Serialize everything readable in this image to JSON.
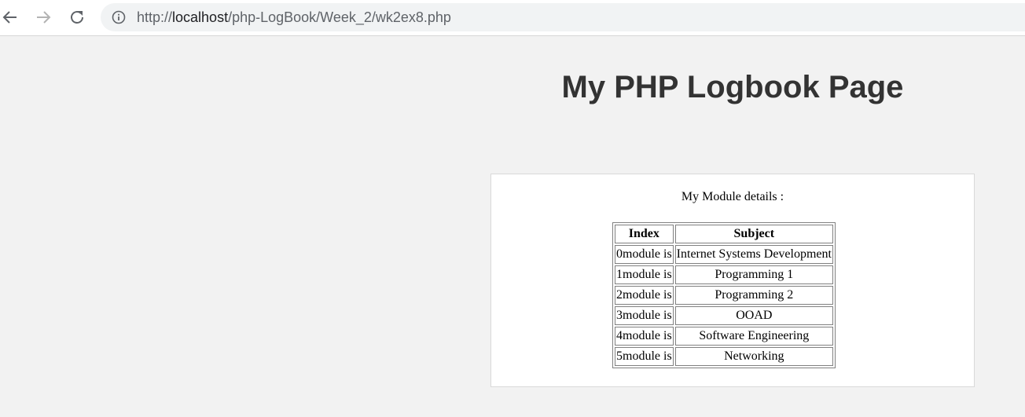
{
  "browser": {
    "url_prefix": "http://",
    "url_host": "localhost",
    "url_path": "/php-LogBook/Week_2/wk2ex8.php"
  },
  "page": {
    "title": "My PHP Logbook Page",
    "caption": "My Module details :"
  },
  "table": {
    "headers": {
      "index": "Index",
      "subject": "Subject"
    },
    "rows": [
      {
        "index": "0module is",
        "subject": "Internet Systems Development"
      },
      {
        "index": "1module is",
        "subject": "Programming 1"
      },
      {
        "index": "2module is",
        "subject": "Programming 2"
      },
      {
        "index": "3module is",
        "subject": "OOAD"
      },
      {
        "index": "4module is",
        "subject": "Software Engineering"
      },
      {
        "index": "5module is",
        "subject": "Networking"
      }
    ]
  }
}
